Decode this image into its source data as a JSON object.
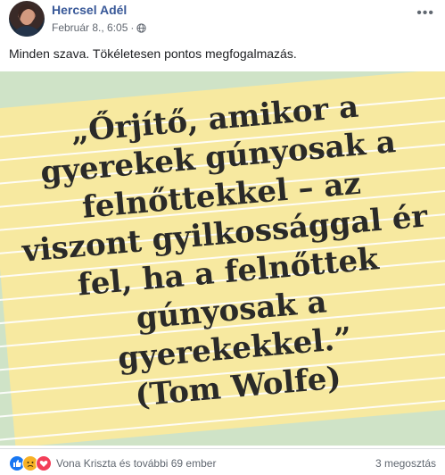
{
  "post": {
    "author": "Hercsel Adél",
    "date": "Február 8., 6:05",
    "separator": "·",
    "text": "Minden szava. Tökéletesen pontos megfogalmazás."
  },
  "image": {
    "quote": "„Őrjítő, amikor a\ngyerekek gúnyosak a\nfelnőttekkel – az\nviszont gyilkossággal ér\nfel, ha a felnőttek\ngúnyosak a\ngyerekekkel.”\n(Tom Wolfe)",
    "colors": {
      "background": "#cfe3c7",
      "paper": "#f7e9a0",
      "lines": "#ffffff"
    }
  },
  "footer": {
    "reactions_text": "Vona Kriszta és további 69 ember",
    "shares_text": "3 megosztás",
    "reaction_icons": [
      "like-icon",
      "sad-icon",
      "love-icon"
    ]
  }
}
